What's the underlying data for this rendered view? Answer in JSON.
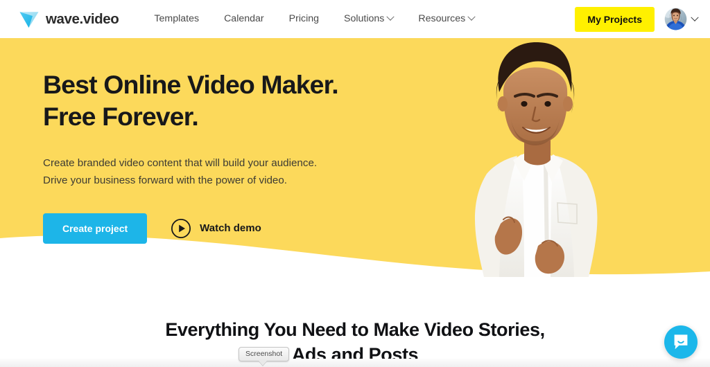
{
  "header": {
    "logo": {
      "icon": "wave-play-triangle-icon",
      "text": "wave.video"
    },
    "nav_items": [
      {
        "label": "Templates",
        "has_dropdown": false
      },
      {
        "label": "Calendar",
        "has_dropdown": false
      },
      {
        "label": "Pricing",
        "has_dropdown": false
      },
      {
        "label": "Solutions",
        "has_dropdown": true
      },
      {
        "label": "Resources",
        "has_dropdown": true
      }
    ],
    "my_projects_label": "My Projects",
    "avatar_alt": "user-avatar",
    "account_chevron": "chevron-down-icon"
  },
  "hero": {
    "title_line1": "Best Online Video Maker.",
    "title_line2": "Free Forever.",
    "subtitle_line1": "Create branded video content that will build your audience.",
    "subtitle_line2": "Drive your business forward with the power of video.",
    "primary_cta": "Create project",
    "secondary_cta": "Watch demo",
    "secondary_cta_icon": "play-circle-icon",
    "photo_alt": "smiling-man-white-shirt"
  },
  "features": {
    "title_line1": "Everything You Need to Make Video Stories,",
    "title_line2": "Ads and Posts"
  },
  "overlay": {
    "screenshot_tooltip": "Screenshot"
  },
  "chat": {
    "icon": "chat-bubble-icon",
    "label": "Open chat"
  },
  "colors": {
    "hero_yellow": "#FCD95B",
    "brand_cyan": "#1DB5E8",
    "projects_yellow": "#FFF000",
    "text_dark": "#17181a",
    "chat_cyan": "#1CB7EA"
  }
}
